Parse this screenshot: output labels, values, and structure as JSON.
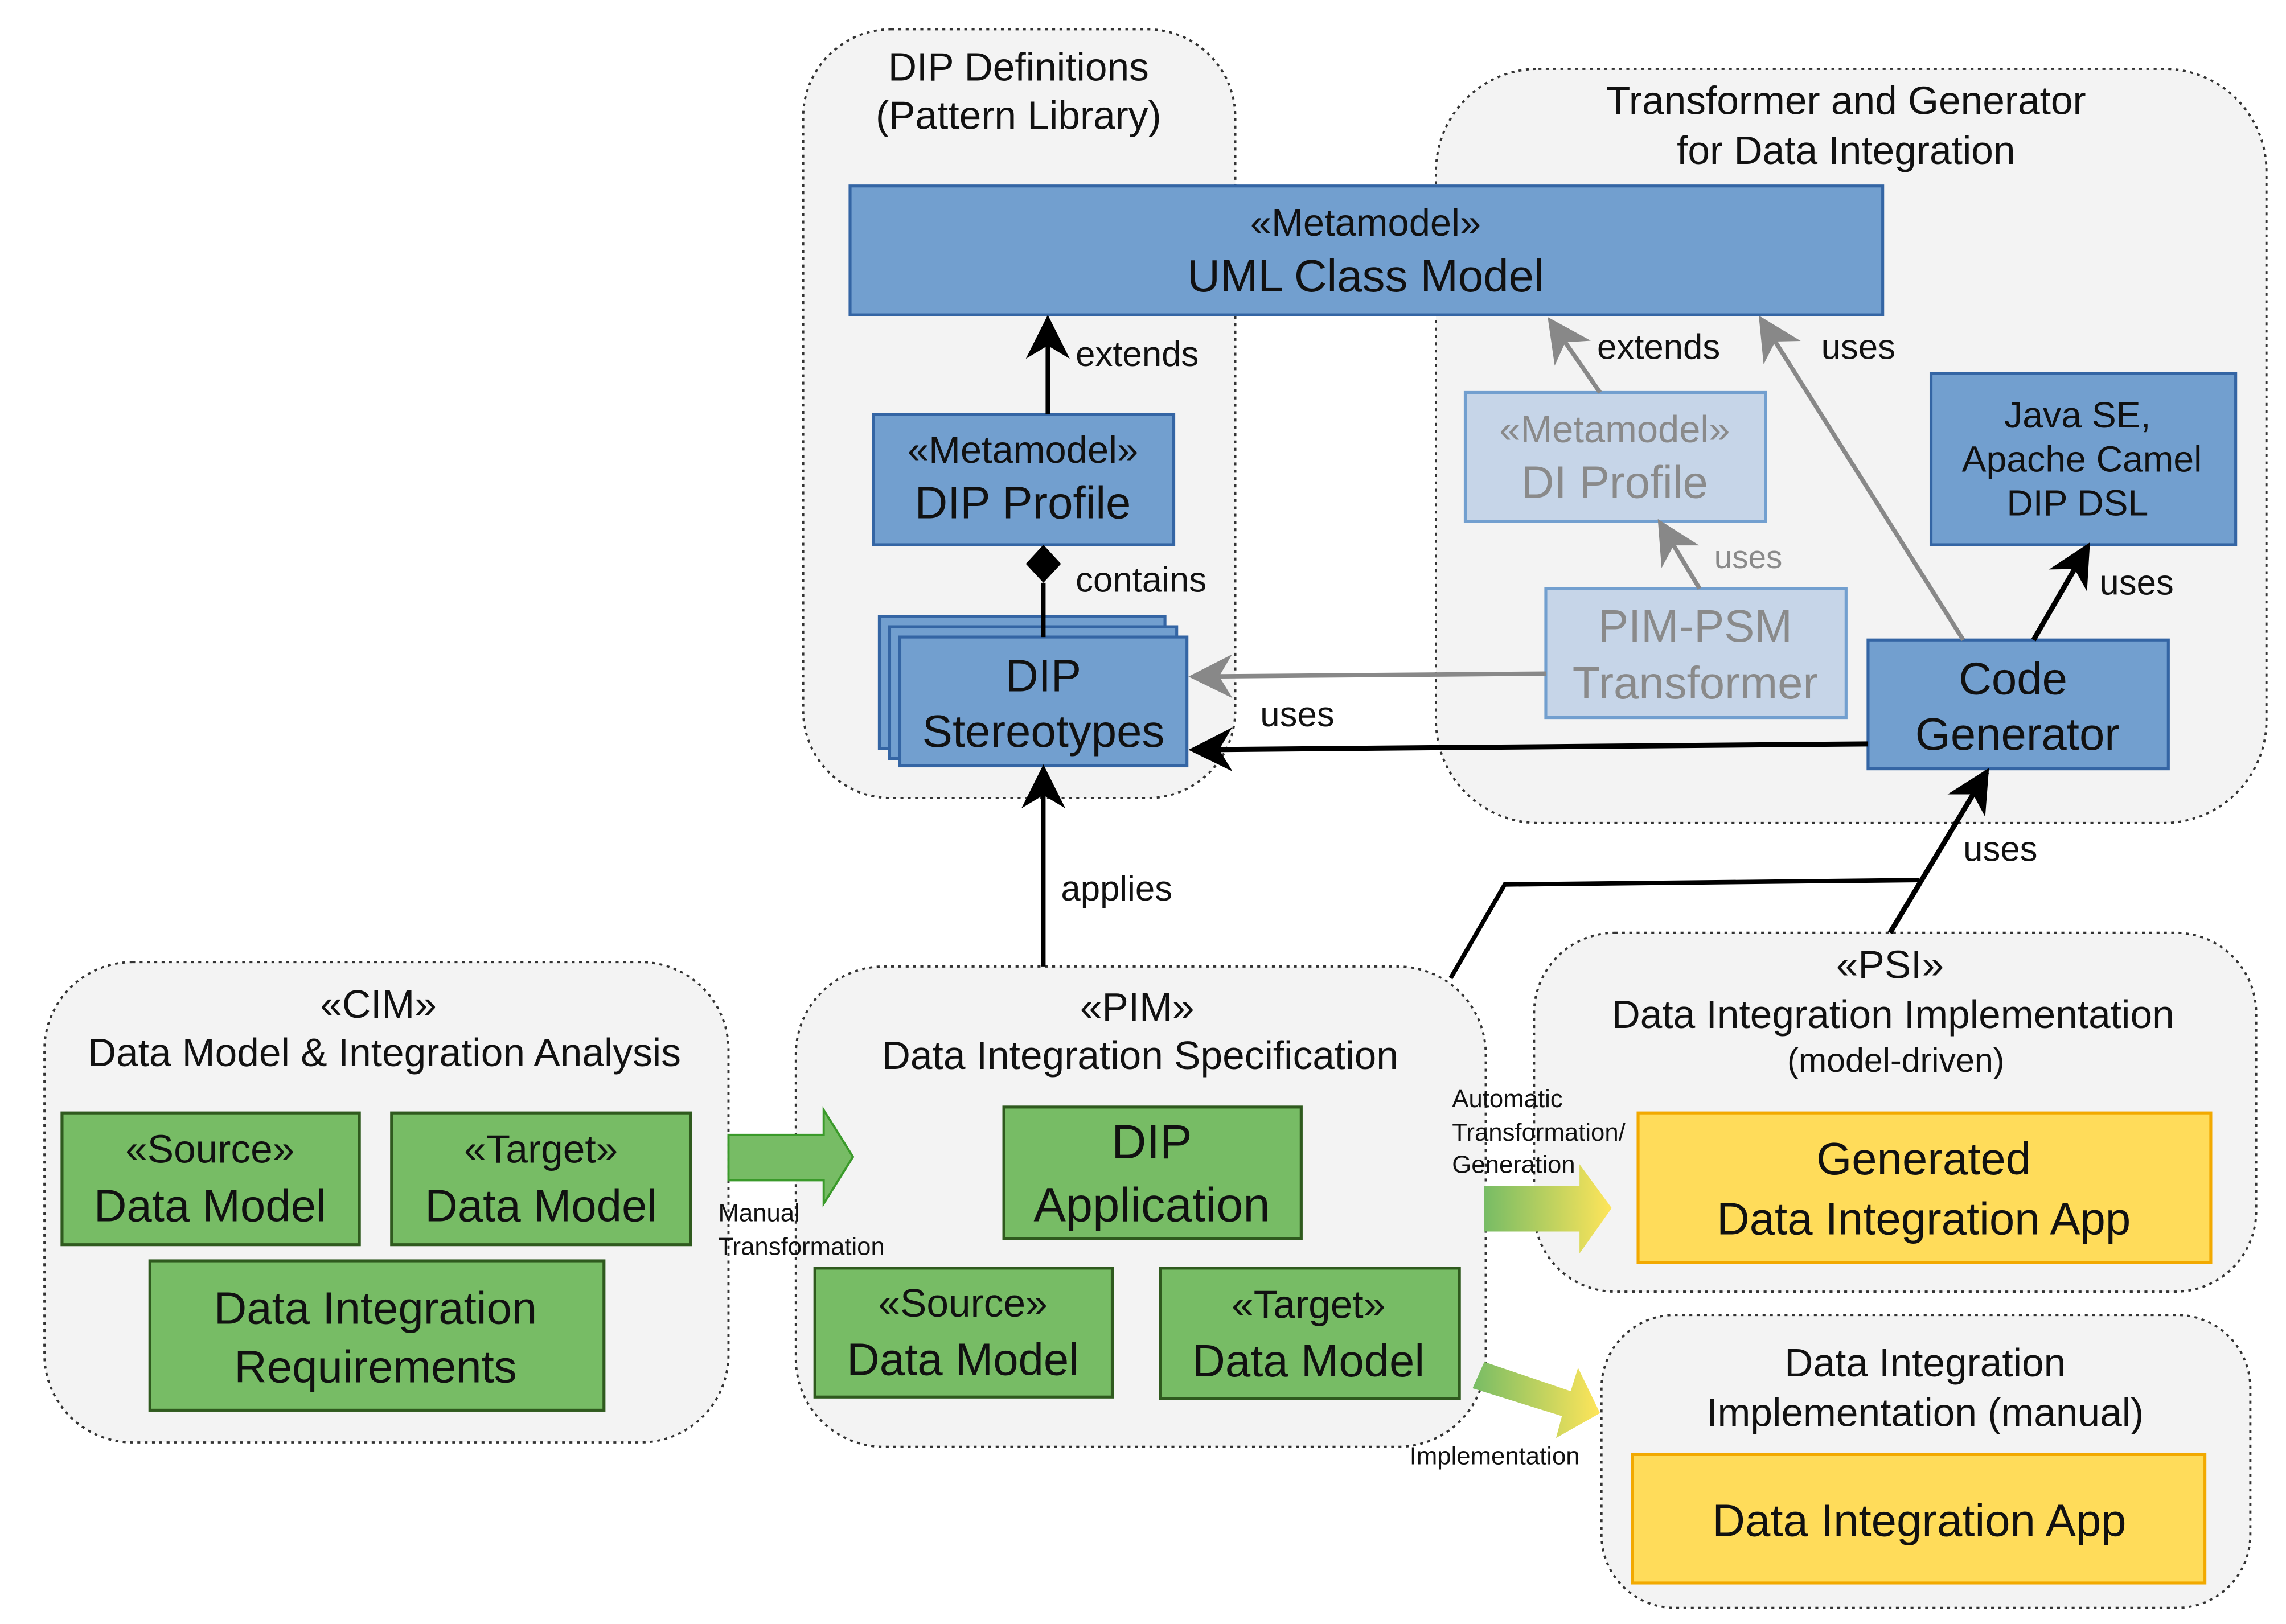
{
  "containers": {
    "dip_definitions": [
      "DIP Definitions",
      "(Pattern Library)"
    ],
    "transformer": [
      "Transformer and Generator",
      "for Data Integration"
    ],
    "cim": [
      "«CIM»",
      "Data Model & Integration Analysis"
    ],
    "pim": [
      "«PIM»",
      "Data Integration Specification"
    ],
    "psi": [
      "«PSI»",
      "Data Integration Implementation",
      "(model-driven)"
    ],
    "manual": [
      "Data Integration",
      "Implementation (manual)"
    ]
  },
  "boxes": {
    "uml": [
      "«Metamodel»",
      "UML Class Model"
    ],
    "dip_profile": [
      "«Metamodel»",
      "DIP Profile"
    ],
    "dip_stereotypes": [
      "DIP",
      "Stereotypes"
    ],
    "di_profile": [
      "«Metamodel»",
      "DI Profile"
    ],
    "pim_psm": [
      "PIM-PSM",
      "Transformer"
    ],
    "java": [
      "Java SE,",
      "Apache Camel",
      "DIP DSL"
    ],
    "code_gen": [
      "Code",
      "Generator"
    ],
    "cim_source": [
      "«Source»",
      "Data Model"
    ],
    "cim_target": [
      "«Target»",
      "Data Model"
    ],
    "requirements": [
      "Data Integration",
      "Requirements"
    ],
    "dip_application": [
      "DIP",
      "Application"
    ],
    "pim_source": [
      "«Source»",
      "Data Model"
    ],
    "pim_target": [
      "«Target»",
      "Data Model"
    ],
    "generated_app": [
      "Generated",
      "Data Integration App"
    ],
    "manual_app": [
      "Data Integration App"
    ]
  },
  "edges": {
    "extends": "extends",
    "contains": "contains",
    "applies": "applies",
    "extends_gray": "extends",
    "uses_di": "uses",
    "uses_uml": "uses",
    "uses_java": "uses",
    "uses_stereo": "uses",
    "uses_codegen": "uses",
    "manual_transformation": [
      "Manual",
      "Transformation"
    ],
    "automatic": [
      "Automatic",
      "Transformation/",
      "Generation"
    ],
    "implementation": "Implementation"
  },
  "colors": {
    "blue": "#729fcf",
    "light_blue": "#c6d5e8",
    "green": "#77bc65",
    "yellow": "#ffdc5a",
    "container": "#f3f3f3"
  }
}
